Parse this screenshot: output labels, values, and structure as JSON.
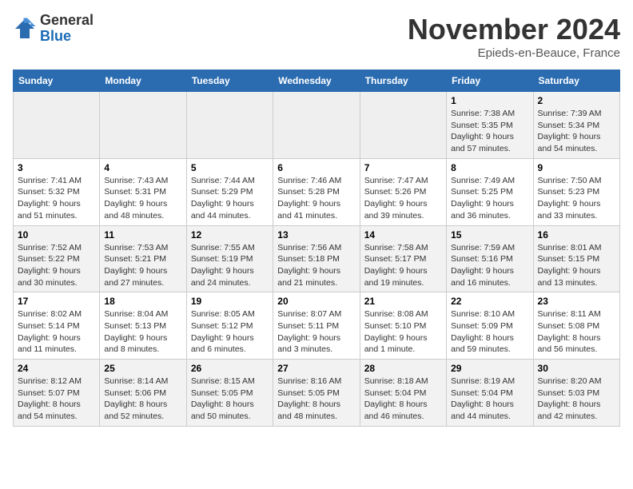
{
  "logo": {
    "general": "General",
    "blue": "Blue"
  },
  "title": "November 2024",
  "location": "Epieds-en-Beauce, France",
  "weekdays": [
    "Sunday",
    "Monday",
    "Tuesday",
    "Wednesday",
    "Thursday",
    "Friday",
    "Saturday"
  ],
  "weeks": [
    [
      {
        "day": "",
        "info": ""
      },
      {
        "day": "",
        "info": ""
      },
      {
        "day": "",
        "info": ""
      },
      {
        "day": "",
        "info": ""
      },
      {
        "day": "",
        "info": ""
      },
      {
        "day": "1",
        "info": "Sunrise: 7:38 AM\nSunset: 5:35 PM\nDaylight: 9 hours and 57 minutes."
      },
      {
        "day": "2",
        "info": "Sunrise: 7:39 AM\nSunset: 5:34 PM\nDaylight: 9 hours and 54 minutes."
      }
    ],
    [
      {
        "day": "3",
        "info": "Sunrise: 7:41 AM\nSunset: 5:32 PM\nDaylight: 9 hours and 51 minutes."
      },
      {
        "day": "4",
        "info": "Sunrise: 7:43 AM\nSunset: 5:31 PM\nDaylight: 9 hours and 48 minutes."
      },
      {
        "day": "5",
        "info": "Sunrise: 7:44 AM\nSunset: 5:29 PM\nDaylight: 9 hours and 44 minutes."
      },
      {
        "day": "6",
        "info": "Sunrise: 7:46 AM\nSunset: 5:28 PM\nDaylight: 9 hours and 41 minutes."
      },
      {
        "day": "7",
        "info": "Sunrise: 7:47 AM\nSunset: 5:26 PM\nDaylight: 9 hours and 39 minutes."
      },
      {
        "day": "8",
        "info": "Sunrise: 7:49 AM\nSunset: 5:25 PM\nDaylight: 9 hours and 36 minutes."
      },
      {
        "day": "9",
        "info": "Sunrise: 7:50 AM\nSunset: 5:23 PM\nDaylight: 9 hours and 33 minutes."
      }
    ],
    [
      {
        "day": "10",
        "info": "Sunrise: 7:52 AM\nSunset: 5:22 PM\nDaylight: 9 hours and 30 minutes."
      },
      {
        "day": "11",
        "info": "Sunrise: 7:53 AM\nSunset: 5:21 PM\nDaylight: 9 hours and 27 minutes."
      },
      {
        "day": "12",
        "info": "Sunrise: 7:55 AM\nSunset: 5:19 PM\nDaylight: 9 hours and 24 minutes."
      },
      {
        "day": "13",
        "info": "Sunrise: 7:56 AM\nSunset: 5:18 PM\nDaylight: 9 hours and 21 minutes."
      },
      {
        "day": "14",
        "info": "Sunrise: 7:58 AM\nSunset: 5:17 PM\nDaylight: 9 hours and 19 minutes."
      },
      {
        "day": "15",
        "info": "Sunrise: 7:59 AM\nSunset: 5:16 PM\nDaylight: 9 hours and 16 minutes."
      },
      {
        "day": "16",
        "info": "Sunrise: 8:01 AM\nSunset: 5:15 PM\nDaylight: 9 hours and 13 minutes."
      }
    ],
    [
      {
        "day": "17",
        "info": "Sunrise: 8:02 AM\nSunset: 5:14 PM\nDaylight: 9 hours and 11 minutes."
      },
      {
        "day": "18",
        "info": "Sunrise: 8:04 AM\nSunset: 5:13 PM\nDaylight: 9 hours and 8 minutes."
      },
      {
        "day": "19",
        "info": "Sunrise: 8:05 AM\nSunset: 5:12 PM\nDaylight: 9 hours and 6 minutes."
      },
      {
        "day": "20",
        "info": "Sunrise: 8:07 AM\nSunset: 5:11 PM\nDaylight: 9 hours and 3 minutes."
      },
      {
        "day": "21",
        "info": "Sunrise: 8:08 AM\nSunset: 5:10 PM\nDaylight: 9 hours and 1 minute."
      },
      {
        "day": "22",
        "info": "Sunrise: 8:10 AM\nSunset: 5:09 PM\nDaylight: 8 hours and 59 minutes."
      },
      {
        "day": "23",
        "info": "Sunrise: 8:11 AM\nSunset: 5:08 PM\nDaylight: 8 hours and 56 minutes."
      }
    ],
    [
      {
        "day": "24",
        "info": "Sunrise: 8:12 AM\nSunset: 5:07 PM\nDaylight: 8 hours and 54 minutes."
      },
      {
        "day": "25",
        "info": "Sunrise: 8:14 AM\nSunset: 5:06 PM\nDaylight: 8 hours and 52 minutes."
      },
      {
        "day": "26",
        "info": "Sunrise: 8:15 AM\nSunset: 5:05 PM\nDaylight: 8 hours and 50 minutes."
      },
      {
        "day": "27",
        "info": "Sunrise: 8:16 AM\nSunset: 5:05 PM\nDaylight: 8 hours and 48 minutes."
      },
      {
        "day": "28",
        "info": "Sunrise: 8:18 AM\nSunset: 5:04 PM\nDaylight: 8 hours and 46 minutes."
      },
      {
        "day": "29",
        "info": "Sunrise: 8:19 AM\nSunset: 5:04 PM\nDaylight: 8 hours and 44 minutes."
      },
      {
        "day": "30",
        "info": "Sunrise: 8:20 AM\nSunset: 5:03 PM\nDaylight: 8 hours and 42 minutes."
      }
    ]
  ]
}
